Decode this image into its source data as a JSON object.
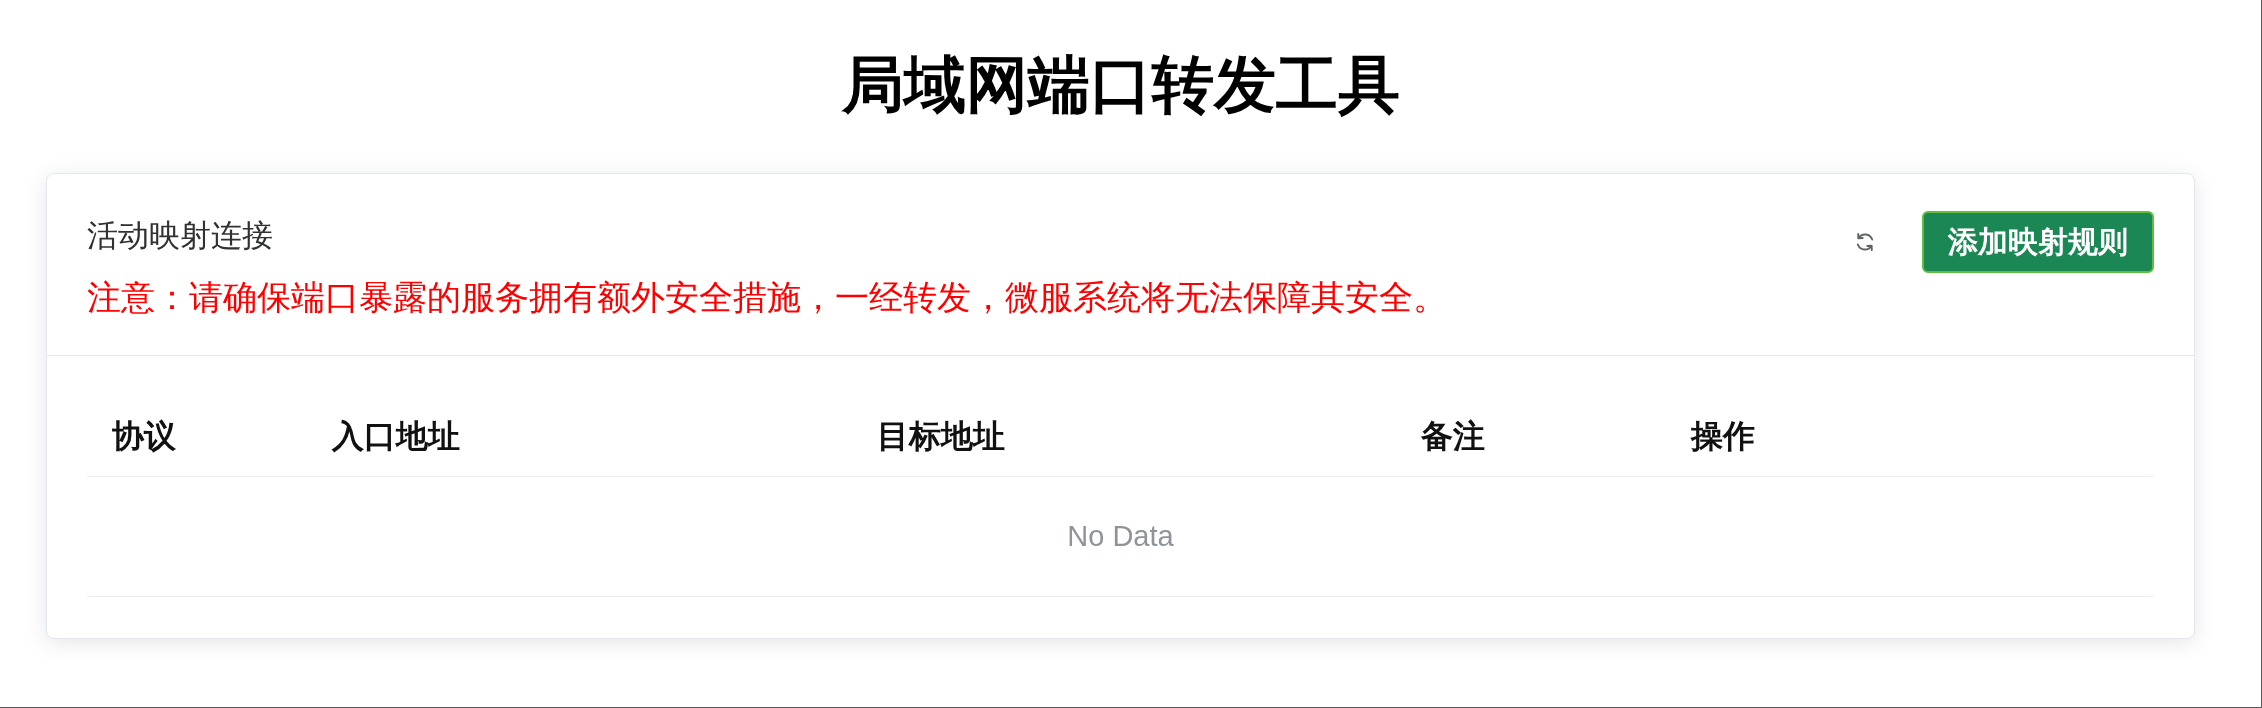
{
  "page": {
    "title": "局域网端口转发工具"
  },
  "card": {
    "title": "活动映射连接",
    "notice": "注意：请确保端口暴露的服务拥有额外安全措施，一经转发，微服系统将无法保障其安全。",
    "add_button": {
      "label": "添加映射规则"
    }
  },
  "table": {
    "columns": [
      "协议",
      "入口地址",
      "目标地址",
      "备注",
      "操作"
    ],
    "empty_text": "No Data"
  }
}
